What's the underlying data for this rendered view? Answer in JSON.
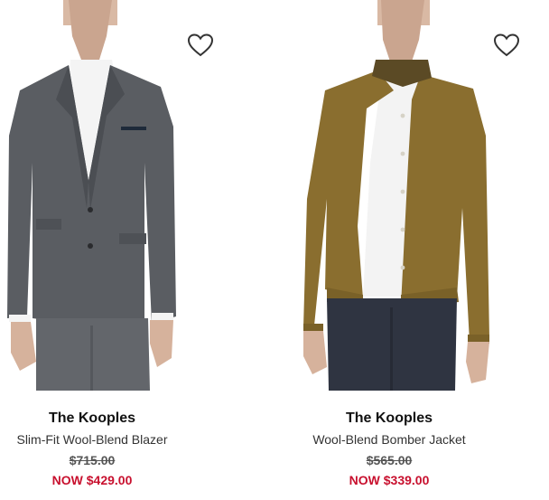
{
  "products": [
    {
      "brand": "The Kooples",
      "name": "Slim-Fit Wool-Blend Blazer",
      "original_price": "$715.00",
      "sale_price": "NOW $429.00",
      "wishlist_icon": "heart-outline-icon"
    },
    {
      "brand": "The Kooples",
      "name": "Wool-Blend Bomber Jacket",
      "original_price": "$565.00",
      "sale_price": "NOW $339.00",
      "wishlist_icon": "heart-outline-icon"
    }
  ],
  "colors": {
    "sale_red": "#c8102e",
    "blazer_grey": "#5a5d62",
    "bomber_olive": "#8a6e2f",
    "collar_brown": "#5b4a25"
  }
}
